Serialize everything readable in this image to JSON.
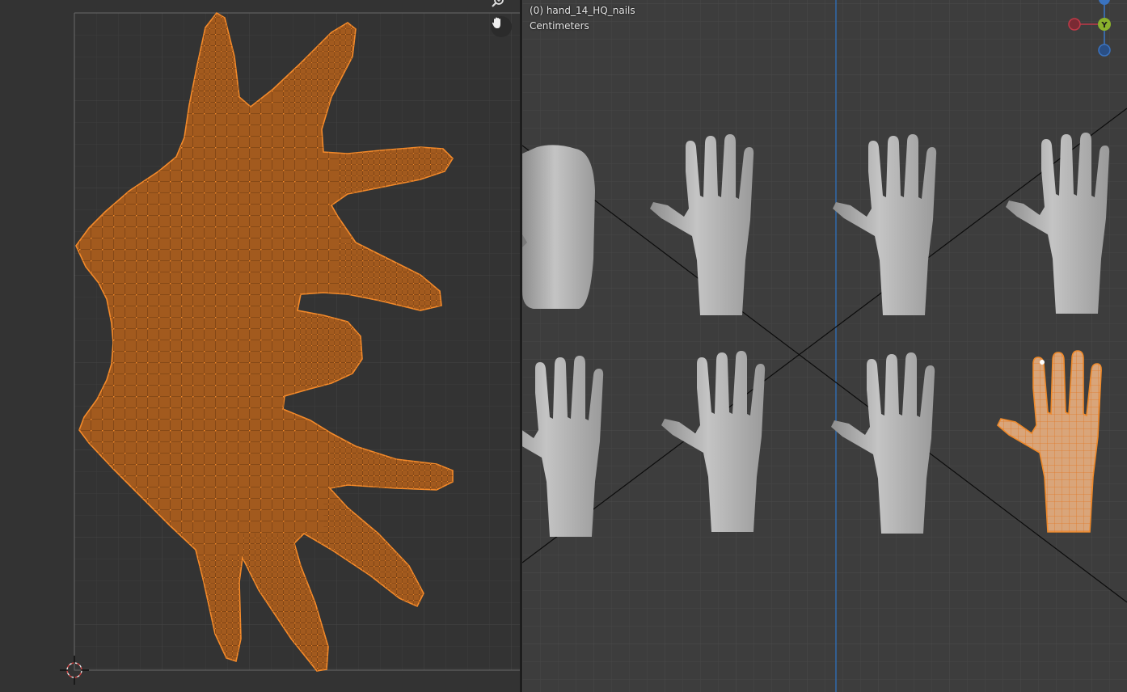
{
  "uv_editor": {
    "tools": [
      {
        "name": "zoom-icon",
        "interactable": true
      },
      {
        "name": "pan-hand-icon",
        "interactable": true
      },
      {
        "name": "2d-cursor-icon",
        "interactable": true
      }
    ],
    "selection_color": "#f48a2a",
    "island_fill": "#a25a1e"
  },
  "viewport": {
    "object_label": "(0) hand_14_HQ_nails",
    "units_label": "Centimeters",
    "gizmo": {
      "y_label": "Y",
      "colors": {
        "x": "#c03a48",
        "y": "#8ab12c",
        "z": "#3a73c0"
      }
    },
    "hands": [
      {
        "row": 1,
        "col": 1,
        "selected": false
      },
      {
        "row": 1,
        "col": 2,
        "selected": false
      },
      {
        "row": 1,
        "col": 3,
        "selected": false
      },
      {
        "row": 1,
        "col": 4,
        "selected": false
      },
      {
        "row": 2,
        "col": 1,
        "selected": false
      },
      {
        "row": 2,
        "col": 2,
        "selected": false
      },
      {
        "row": 2,
        "col": 3,
        "selected": false
      },
      {
        "row": 2,
        "col": 4,
        "selected": true
      }
    ],
    "mesh_color": "#b0b0b0",
    "selected_color": "#e07a2a"
  }
}
